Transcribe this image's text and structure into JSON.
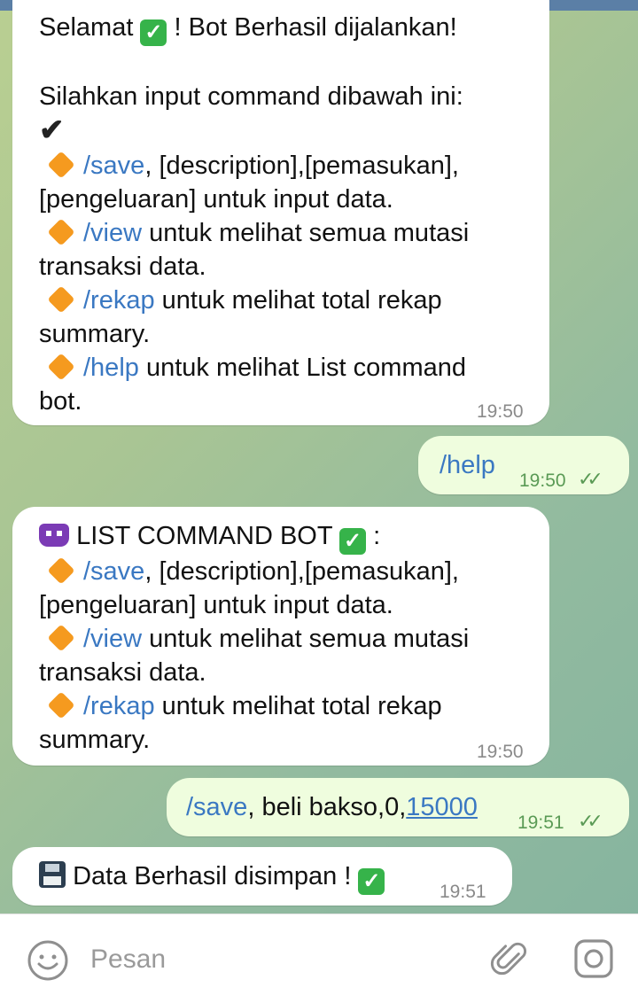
{
  "messages": {
    "welcome": {
      "line1_a": "Selamat",
      "line1_b": "! Bot Berhasil dijalankan!",
      "line2": "Silahkan input command dibawah ini:",
      "checkmark": "✔",
      "items": [
        {
          "cmd": "/save",
          "rest": ", [description],[pemasukan],",
          "cont": "[pengeluaran] untuk input data."
        },
        {
          "cmd": "/view",
          "rest": " untuk melihat semua mutasi",
          "cont": "transaksi data."
        },
        {
          "cmd": "/rekap",
          "rest": " untuk melihat total rekap",
          "cont": "summary."
        },
        {
          "cmd": "/help",
          "rest": " untuk melihat List command",
          "cont": "bot."
        }
      ],
      "time": "19:50"
    },
    "help_cmd": {
      "text": "/help",
      "time": "19:50"
    },
    "list_bot": {
      "title": "LIST COMMAND BOT",
      "title_suffix": ":",
      "items": [
        {
          "cmd": "/save",
          "rest": ", [description],[pemasukan],",
          "cont": "[pengeluaran] untuk input data."
        },
        {
          "cmd": "/view",
          "rest": " untuk melihat semua mutasi",
          "cont": "transaksi data."
        },
        {
          "cmd": "/rekap",
          "rest": " untuk melihat total rekap",
          "cont": "summary."
        }
      ],
      "time": "19:50"
    },
    "save_cmd": {
      "cmd": "/save",
      "text": ", beli bakso,0,",
      "link": "15000",
      "time": "19:51"
    },
    "saved": {
      "text": "Data Berhasil disimpan !",
      "time": "19:51"
    }
  },
  "input": {
    "placeholder": "Pesan"
  },
  "icons": {
    "emoji": "smile-icon",
    "attach": "paperclip-icon",
    "camera": "camera-icon",
    "check": "check-mark-button-icon",
    "diamond": "orange-diamond-icon",
    "invader": "alien-monster-icon",
    "floppy": "floppy-disk-icon",
    "ticks": "double-check-icon"
  },
  "colors": {
    "incoming_bubble": "#ffffff",
    "outgoing_bubble": "#effdde",
    "command_link": "#3a78c2",
    "read_ticks": "#5a9a55"
  }
}
